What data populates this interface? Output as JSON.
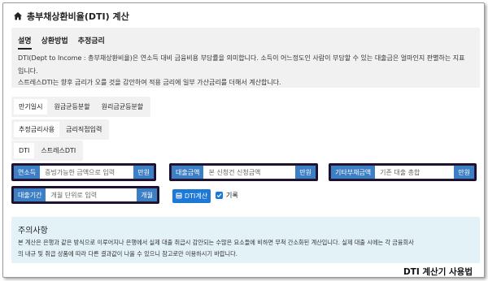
{
  "title": "총부채상환비율(DTI) 계산",
  "tabs": [
    {
      "label": "설명",
      "active": true
    },
    {
      "label": "상환방법",
      "active": false
    },
    {
      "label": "추정금리",
      "active": false
    }
  ],
  "info": {
    "line1": "DTI(Dept to Income : 총부채상환비율)은 연소득 대비 금융비용 부담률을 의미합니다. 소득이 어느정도인 사람이 부담할 수 있는 대출금은 얼마인지 판별하는 지표",
    "line2": "입니다.",
    "line3": "스트레스DTI는 향후 금리가 오를 것을 감안하여 적용 금리에 일부 가산금리를 더해서 계산합니다."
  },
  "repayment_options": [
    "만기일시",
    "원금균등분할",
    "원리금균등분할"
  ],
  "rate_options": [
    "추정금리사용",
    "금리직접입력"
  ],
  "dti_options": [
    "DTI",
    "스트레스DTI"
  ],
  "fields": {
    "income": {
      "label": "연소득",
      "placeholder": "증빙가능한 금액으로 입력",
      "unit": "만원"
    },
    "loan_amount": {
      "label": "대출금액",
      "placeholder": "본 신청건 신청금액",
      "unit": "만원"
    },
    "other_debt": {
      "label": "기타부채금액",
      "placeholder": "기존 대출 총합",
      "unit": "만원"
    },
    "loan_period": {
      "label": "대출기간",
      "placeholder": "개월 단위로 입력",
      "unit": "개월"
    }
  },
  "calc_button": "DTI계산",
  "record_checkbox": {
    "label": "기록",
    "checked": true
  },
  "caution": {
    "title": "주의사항",
    "line1": "본 계산은 은행과 같은 방식으로 이루어지나 은행에서 실제 대출 취급시 감안되는 수많은 요소들에 비하면 무척 간소화된 계산입니다. 실제 대출 시에는 각 금융회사",
    "line2": "의 내규 및 취급 상품에 따라 다른 결과값이 나올 수 있으니 참고로만 이용하시기 바랍니다."
  },
  "footer_text": "DTI 계산기 사용법",
  "colors": {
    "accent": "#3d7fc4",
    "button": "#1e78d6",
    "caution_bg": "#e3f2f6",
    "info_bg": "#f1f1f1"
  }
}
